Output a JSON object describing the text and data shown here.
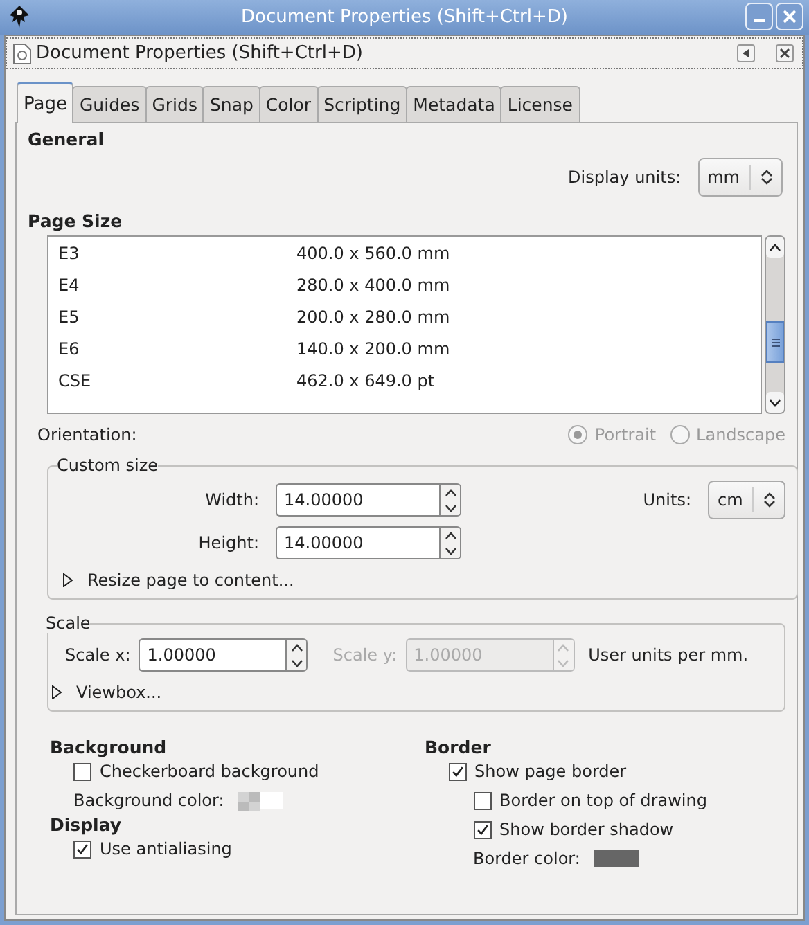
{
  "window": {
    "title": "Document Properties (Shift+Ctrl+D)"
  },
  "dock": {
    "title": "Document Properties (Shift+Ctrl+D)"
  },
  "tabs": [
    {
      "label": "Page",
      "selected": true
    },
    {
      "label": "Guides",
      "selected": false
    },
    {
      "label": "Grids",
      "selected": false
    },
    {
      "label": "Snap",
      "selected": false
    },
    {
      "label": "Color",
      "selected": false
    },
    {
      "label": "Scripting",
      "selected": false
    },
    {
      "label": "Metadata",
      "selected": false
    },
    {
      "label": "License",
      "selected": false
    }
  ],
  "general": {
    "heading": "General",
    "display_units": {
      "label": "Display units:",
      "value": "mm"
    }
  },
  "page_size": {
    "heading": "Page Size",
    "rows": [
      {
        "name": "E3",
        "size": "400.0 x 560.0 mm"
      },
      {
        "name": "E4",
        "size": "280.0 x 400.0 mm"
      },
      {
        "name": "E5",
        "size": "200.0 x 280.0 mm"
      },
      {
        "name": "E6",
        "size": "140.0 x 200.0 mm"
      },
      {
        "name": "CSE",
        "size": "462.0 x 649.0 pt"
      }
    ]
  },
  "orientation": {
    "label": "Orientation:",
    "disabled": true,
    "options": [
      {
        "label": "Portrait",
        "selected": true
      },
      {
        "label": "Landscape",
        "selected": false
      }
    ]
  },
  "custom_size": {
    "title": "Custom size",
    "width": {
      "label": "Width:",
      "value": "14.00000"
    },
    "height": {
      "label": "Height:",
      "value": "14.00000"
    },
    "units": {
      "label": "Units:",
      "value": "cm"
    },
    "expander": {
      "label": "Resize page to content...",
      "expanded": false
    }
  },
  "scale": {
    "title": "Scale",
    "scale_x": {
      "label": "Scale x:",
      "value": "1.00000",
      "disabled": false
    },
    "scale_y": {
      "label": "Scale y:",
      "value": "1.00000",
      "disabled": true
    },
    "note": "User units per mm.",
    "expander": {
      "label": "Viewbox...",
      "expanded": false
    }
  },
  "background": {
    "heading": "Background",
    "checkboxes": [
      {
        "label": "Checkerboard background",
        "checked": false
      }
    ],
    "color": {
      "label": "Background color:",
      "color": "#ffffff"
    }
  },
  "display": {
    "heading": "Display",
    "checkboxes": [
      {
        "label": "Use antialiasing",
        "checked": true
      }
    ]
  },
  "border": {
    "heading": "Border",
    "checkboxes": [
      {
        "label": "Show page border",
        "checked": true,
        "children": [
          {
            "label": "Border on top of drawing",
            "checked": false
          },
          {
            "label": "Show border shadow",
            "checked": true
          }
        ]
      }
    ],
    "color": {
      "label": "Border color:",
      "color": "#666666"
    }
  }
}
